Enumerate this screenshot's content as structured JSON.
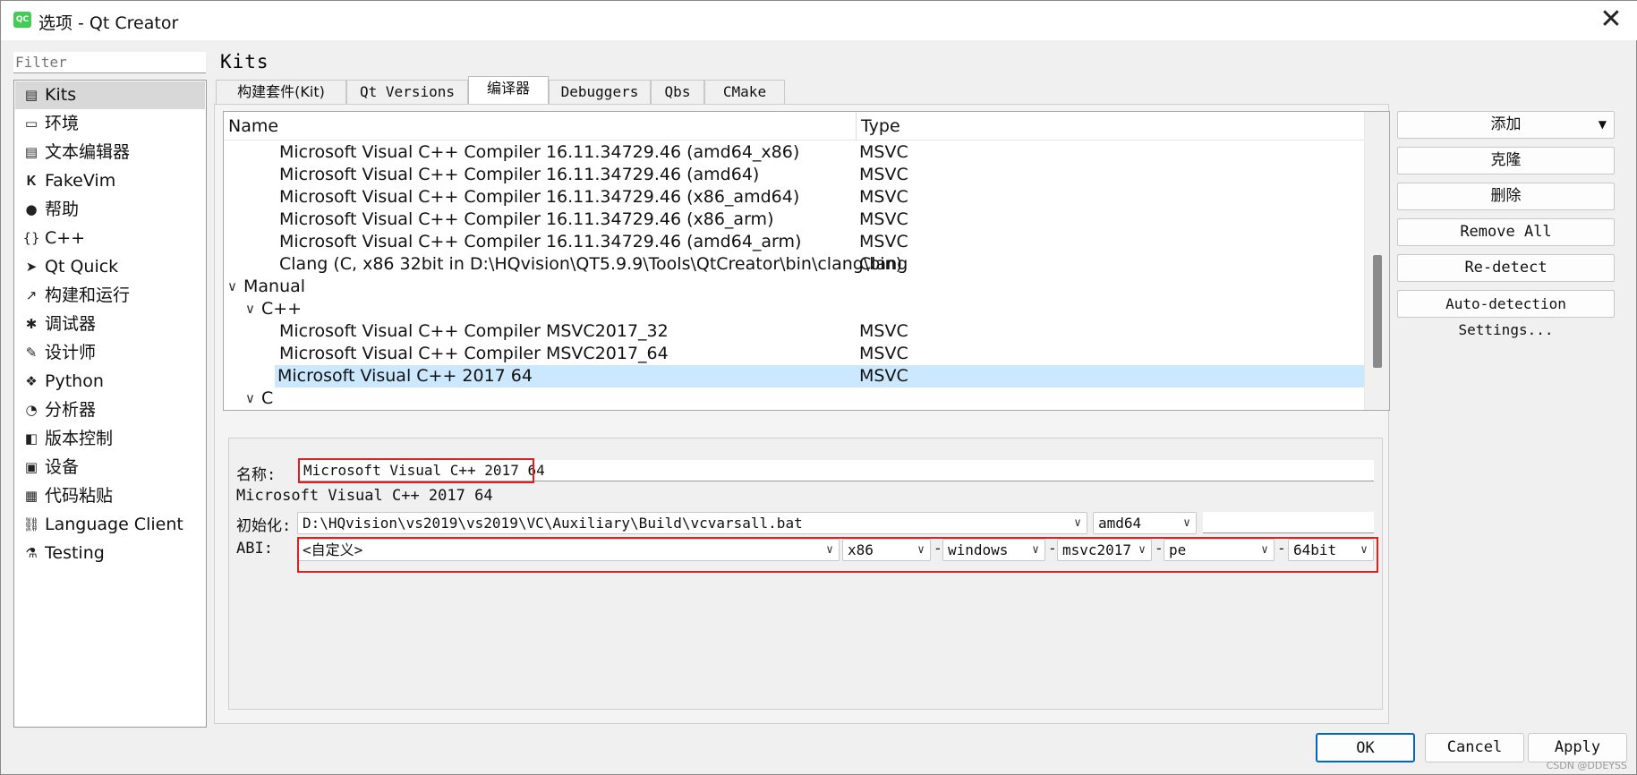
{
  "window": {
    "title": "选项 - Qt Creator",
    "app_icon_text": "QC",
    "close_glyph": "✕"
  },
  "filter": {
    "placeholder": "Filter"
  },
  "sidebar": {
    "items": [
      {
        "label": "Kits",
        "icon": "kits-icon",
        "glyph": "▤",
        "selected": true
      },
      {
        "label": "环境",
        "icon": "monitor-icon",
        "glyph": "▭"
      },
      {
        "label": "文本编辑器",
        "icon": "text-editor-icon",
        "glyph": "▤"
      },
      {
        "label": "FakeVim",
        "icon": "fakevim-icon",
        "glyph": "𝐊"
      },
      {
        "label": "帮助",
        "icon": "help-icon",
        "glyph": "●"
      },
      {
        "label": "C++",
        "icon": "braces-icon",
        "glyph": "{}"
      },
      {
        "label": "Qt Quick",
        "icon": "qt-quick-icon",
        "glyph": "➤"
      },
      {
        "label": "构建和运行",
        "icon": "hammer-icon",
        "glyph": "↗"
      },
      {
        "label": "调试器",
        "icon": "bug-icon",
        "glyph": "✱"
      },
      {
        "label": "设计师",
        "icon": "pen-icon",
        "glyph": "✎"
      },
      {
        "label": "Python",
        "icon": "python-icon",
        "glyph": "❖"
      },
      {
        "label": "分析器",
        "icon": "analyzer-icon",
        "glyph": "◔"
      },
      {
        "label": "版本控制",
        "icon": "version-control-icon",
        "glyph": "◧"
      },
      {
        "label": "设备",
        "icon": "device-icon",
        "glyph": "▣"
      },
      {
        "label": "代码粘贴",
        "icon": "code-paste-icon",
        "glyph": "▦"
      },
      {
        "label": "Language Client",
        "icon": "language-client-icon",
        "glyph": "⛓"
      },
      {
        "label": "Testing",
        "icon": "testing-icon",
        "glyph": "⚗"
      }
    ]
  },
  "page": {
    "title": "Kits"
  },
  "tabs": [
    {
      "label": "构建套件(Kit)"
    },
    {
      "label": "Qt Versions"
    },
    {
      "label": "编译器",
      "active": true
    },
    {
      "label": "Debuggers"
    },
    {
      "label": "Qbs"
    },
    {
      "label": "CMake"
    }
  ],
  "tree": {
    "columns": {
      "name": "Name",
      "type": "Type"
    },
    "rows": [
      {
        "name": "Microsoft Visual C++ Compiler 16.11.34729.46 (amd64_x86)",
        "type": "MSVC",
        "level": 2
      },
      {
        "name": "Microsoft Visual C++ Compiler 16.11.34729.46 (amd64)",
        "type": "MSVC",
        "level": 2
      },
      {
        "name": "Microsoft Visual C++ Compiler 16.11.34729.46 (x86_amd64)",
        "type": "MSVC",
        "level": 2
      },
      {
        "name": "Microsoft Visual C++ Compiler 16.11.34729.46 (x86_arm)",
        "type": "MSVC",
        "level": 2
      },
      {
        "name": "Microsoft Visual C++ Compiler 16.11.34729.46 (amd64_arm)",
        "type": "MSVC",
        "level": 2
      },
      {
        "name": "Clang (C, x86 32bit in D:\\HQvision\\QT5.9.9\\Tools\\QtCreator\\bin\\clang\\bin)",
        "type": "Clang",
        "level": 2
      },
      {
        "name": "Manual",
        "type": "",
        "level": 0,
        "expander": "∨"
      },
      {
        "name": "C++",
        "type": "",
        "level": 1,
        "expander": "∨"
      },
      {
        "name": "Microsoft Visual C++ Compiler MSVC2017_32",
        "type": "MSVC",
        "level": 2
      },
      {
        "name": "Microsoft Visual C++ Compiler MSVC2017_64",
        "type": "MSVC",
        "level": 2
      },
      {
        "name": "Microsoft Visual C++ 2017 64",
        "type": "MSVC",
        "level": 2,
        "selected": true
      },
      {
        "name": "C",
        "type": "",
        "level": 1,
        "expander": "∨"
      }
    ]
  },
  "actions": {
    "add": "添加",
    "add_arrow": "▼",
    "clone": "克隆",
    "remove": "删除",
    "remove_all": "Remove All",
    "redetect": "Re-detect",
    "auto_detection": "Auto-detection Settings..."
  },
  "details": {
    "name_label": "名称:",
    "name_value": "Microsoft Visual C++ 2017 64",
    "description": "Microsoft Visual C++ 2017 64",
    "init_label": "初始化:",
    "init_value": "D:\\HQvision\\vs2019\\vs2019\\VC\\Auxiliary\\Build\\vcvarsall.bat",
    "arch_value": "amd64",
    "args_value": "",
    "abi_label": "ABI:",
    "abi": {
      "preset": "<自定义>",
      "arch": "x86",
      "os": "windows",
      "flavor": "msvc2017",
      "format": "pe",
      "width": "64bit",
      "separator": "-"
    },
    "arrow": "∨"
  },
  "footer": {
    "ok": "OK",
    "cancel": "Cancel",
    "apply": "Apply"
  },
  "watermark": "CSDN @DDEYSS",
  "colors": {
    "selection": "#cce8ff",
    "highlight_box": "#e02020",
    "default_button": "#0067c0"
  }
}
